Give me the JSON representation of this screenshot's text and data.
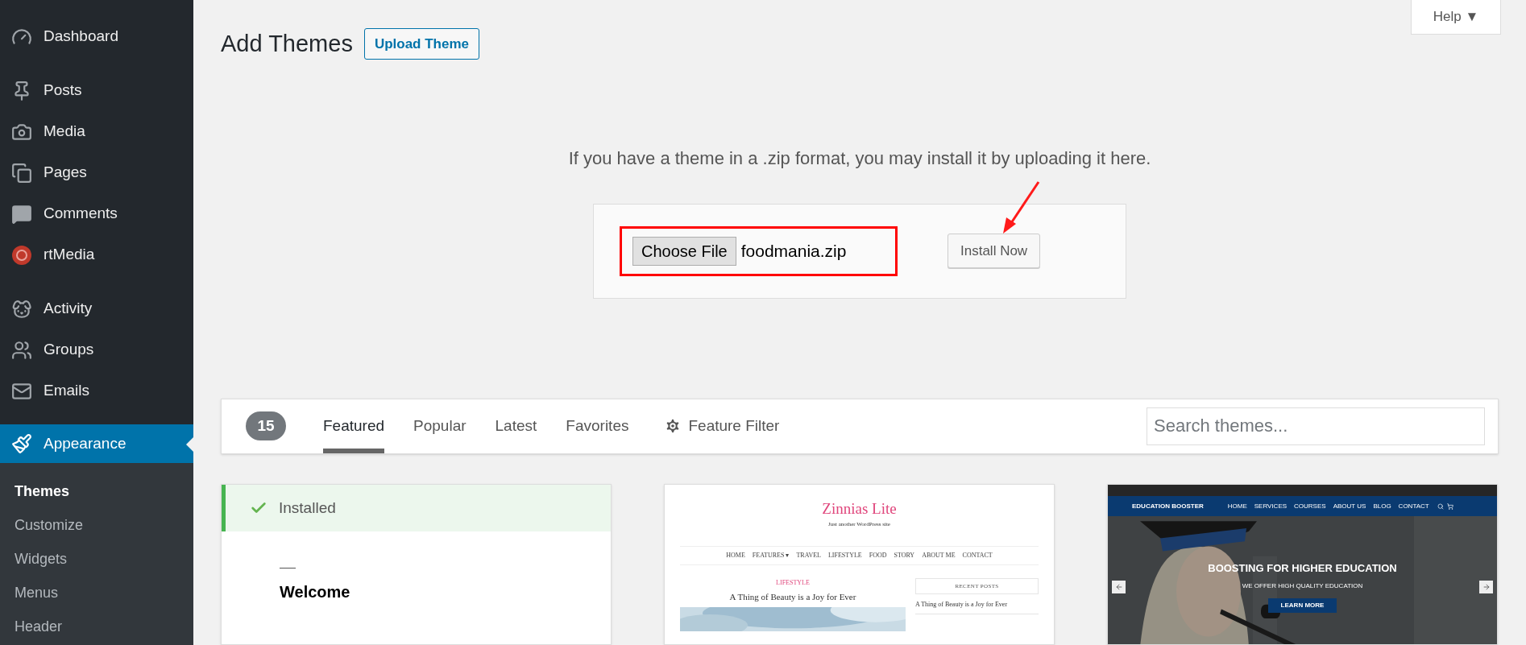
{
  "sidebar": {
    "items": [
      {
        "label": "Dashboard",
        "selected": false
      },
      {
        "label": "Posts",
        "selected": false
      },
      {
        "label": "Media",
        "selected": false
      },
      {
        "label": "Pages",
        "selected": false
      },
      {
        "label": "Comments",
        "selected": false
      },
      {
        "label": "rtMedia",
        "selected": false
      },
      {
        "label": "Activity",
        "selected": false
      },
      {
        "label": "Groups",
        "selected": false
      },
      {
        "label": "Emails",
        "selected": false
      },
      {
        "label": "Appearance",
        "selected": true
      }
    ],
    "submenu": [
      {
        "label": "Themes",
        "selected": true
      },
      {
        "label": "Customize",
        "selected": false
      },
      {
        "label": "Widgets",
        "selected": false
      },
      {
        "label": "Menus",
        "selected": false
      },
      {
        "label": "Header",
        "selected": false
      }
    ]
  },
  "page": {
    "title": "Add Themes",
    "upload_button": "Upload Theme",
    "help": "Help ▼"
  },
  "upload": {
    "description": "If you have a theme in a .zip format, you may install it by uploading it here.",
    "choose_button": "Choose File",
    "file_name": "foodmania.zip",
    "install_button": "Install Now",
    "highlighted": true
  },
  "filter": {
    "count": "15",
    "tabs": [
      {
        "label": "Featured",
        "selected": true
      },
      {
        "label": "Popular",
        "selected": false
      },
      {
        "label": "Latest",
        "selected": false
      },
      {
        "label": "Favorites",
        "selected": false
      }
    ],
    "feature_filter": "Feature Filter",
    "search_placeholder": "Search themes..."
  },
  "themes": [
    {
      "kind": "installed",
      "status": "Installed",
      "heading": "Welcome"
    },
    {
      "kind": "blog",
      "title": "Zinnias Lite",
      "tagline": "Just another WordPress site",
      "nav": [
        "HOME",
        "FEATURES ▾",
        "TRAVEL",
        "LIFESTYLE",
        "FOOD",
        "STORY",
        "ABOUT ME",
        "CONTACT"
      ],
      "category": "LIFESTYLE",
      "post_title": "A Thing of Beauty is a Joy for Ever",
      "sidebar_heading": "RECENT POSTS",
      "recent": [
        "A Thing of Beauty is a Joy for Ever"
      ]
    },
    {
      "kind": "education",
      "brand": "EDUCATION BOOSTER",
      "nav": [
        "HOME",
        "SERVICES",
        "COURSES",
        "ABOUT US",
        "BLOG",
        "CONTACT"
      ],
      "headline": "BOOSTING FOR HIGHER EDUCATION",
      "subline": "WE OFFER HIGH QUALITY EDUCATION",
      "button": "LEARN MORE"
    }
  ]
}
